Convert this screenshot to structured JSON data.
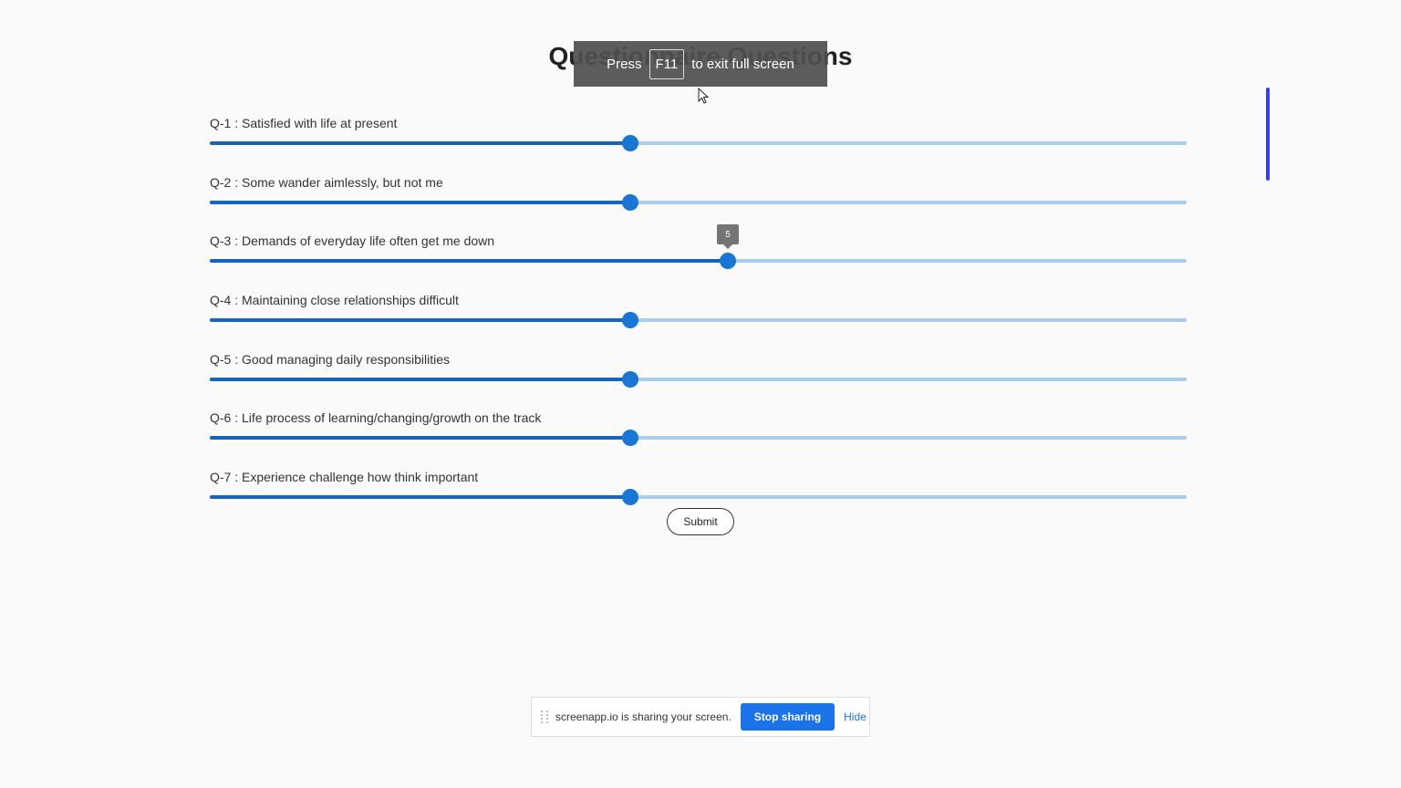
{
  "page": {
    "title": "Questionnaire Questions"
  },
  "fullscreen_toast": {
    "press": "Press",
    "key": "F11",
    "rest": "to exit full screen"
  },
  "questions": [
    {
      "label": "Q-1 : Satisfied with life at present",
      "value_fraction": 0.43
    },
    {
      "label": "Q-2 : Some wander aimlessly, but not me",
      "value_fraction": 0.43
    },
    {
      "label": "Q-3 : Demands of everyday life often get me down",
      "value_fraction": 0.53,
      "value_label": "5"
    },
    {
      "label": "Q-4 : Maintaining close relationships difficult",
      "value_fraction": 0.43
    },
    {
      "label": "Q-5 : Good managing daily responsibilities",
      "value_fraction": 0.43
    },
    {
      "label": "Q-6 : Life process of learning/changing/growth on the track",
      "value_fraction": 0.43
    },
    {
      "label": "Q-7 : Experience challenge how think important",
      "value_fraction": 0.43
    }
  ],
  "submit_label": "Submit",
  "share_bar": {
    "message": "screenapp.io is sharing your screen.",
    "stop_label": "Stop sharing",
    "hide_label": "Hide"
  },
  "colors": {
    "slider_fill": "#1565c0",
    "slider_track": "#a8cdee",
    "accent": "#1a73e8"
  }
}
